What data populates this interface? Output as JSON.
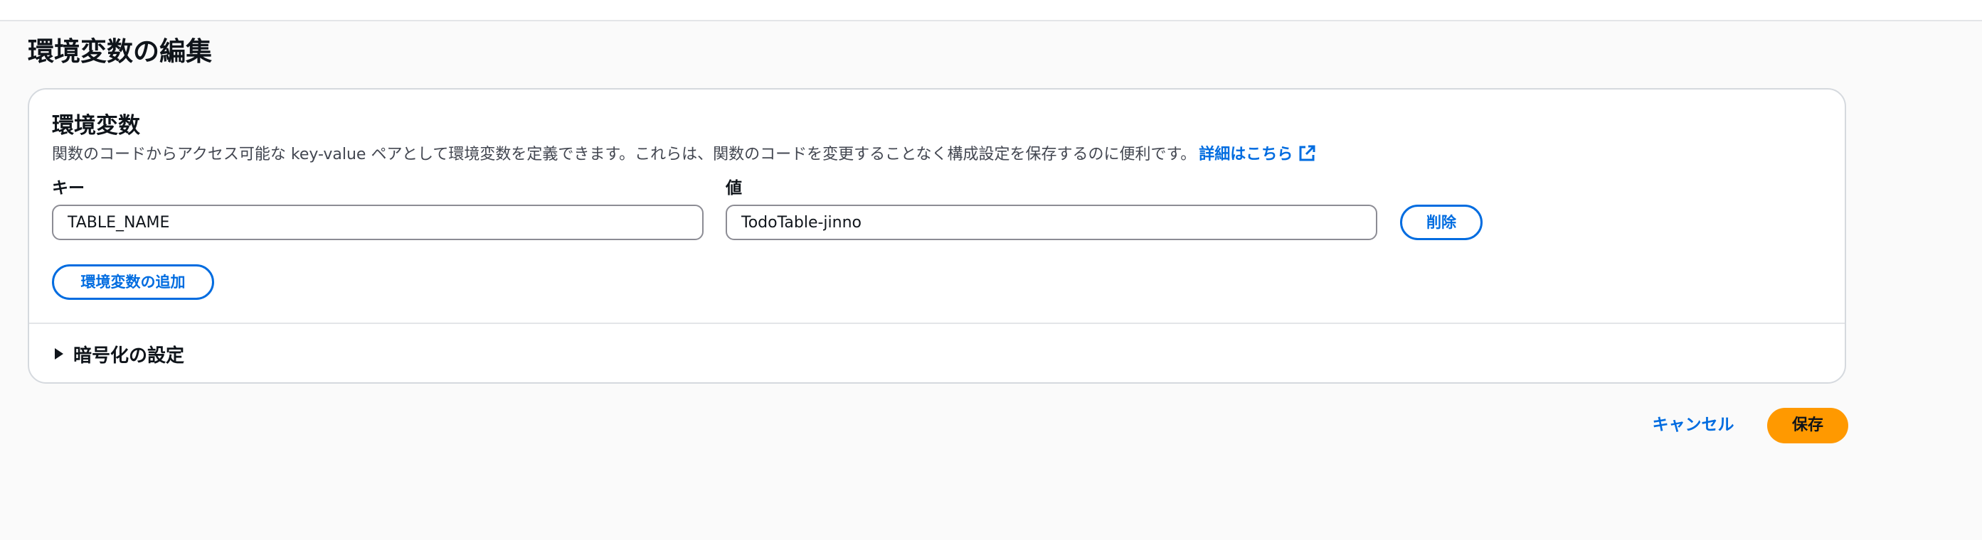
{
  "page": {
    "title": "環境変数の編集"
  },
  "panel": {
    "title": "環境変数",
    "description": "関数のコードからアクセス可能な key-value ペアとして環境変数を定義できます。これらは、関数のコードを変更することなく構成設定を保存するのに便利です。",
    "learn_more_label": "詳細はこちら",
    "key_label": "キー",
    "value_label": "値",
    "variables": [
      {
        "key": "TABLE_NAME",
        "value": "TodoTable-jinno",
        "remove_label": "削除"
      }
    ],
    "add_button_label": "環境変数の追加",
    "encryption_expander_label": "暗号化の設定"
  },
  "footer": {
    "cancel_label": "キャンセル",
    "save_label": "保存"
  },
  "colors": {
    "link": "#006ce0",
    "primary_button": "#ff9900",
    "background": "#fafafa"
  }
}
